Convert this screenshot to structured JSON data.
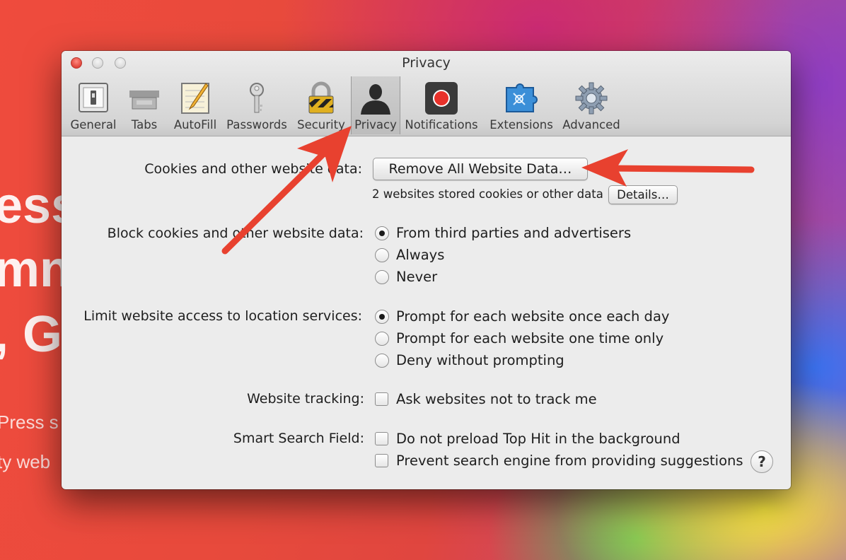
{
  "background": {
    "large_text": [
      "ess",
      "mn",
      ", G"
    ],
    "small_text": [
      "Press s",
      "ty web"
    ]
  },
  "window": {
    "title": "Privacy"
  },
  "toolbar": {
    "tabs": [
      {
        "label": "General",
        "icon": "general-switch-icon"
      },
      {
        "label": "Tabs",
        "icon": "tabs-icon"
      },
      {
        "label": "AutoFill",
        "icon": "autofill-pencil-icon"
      },
      {
        "label": "Passwords",
        "icon": "key-icon"
      },
      {
        "label": "Security",
        "icon": "padlock-icon"
      },
      {
        "label": "Privacy",
        "icon": "person-silhouette-icon"
      },
      {
        "label": "Notifications",
        "icon": "notifications-red-dot-icon"
      },
      {
        "label": "Extensions",
        "icon": "puzzle-piece-icon"
      },
      {
        "label": "Advanced",
        "icon": "gear-icon"
      }
    ],
    "selected": "Privacy"
  },
  "cookies": {
    "label": "Cookies and other website data:",
    "remove_button": "Remove All Website Data…",
    "status": "2 websites stored cookies or other data",
    "details_button": "Details…"
  },
  "block_cookies": {
    "label": "Block cookies and other website data:",
    "options": [
      "From third parties and advertisers",
      "Always",
      "Never"
    ],
    "selected": "From third parties and advertisers"
  },
  "location": {
    "label": "Limit website access to location services:",
    "options": [
      "Prompt for each website once each day",
      "Prompt for each website one time only",
      "Deny without prompting"
    ],
    "selected": "Prompt for each website once each day"
  },
  "tracking": {
    "label": "Website tracking:",
    "option": "Ask websites not to track me",
    "checked": false
  },
  "smart_search": {
    "label": "Smart Search Field:",
    "options": [
      "Do not preload Top Hit in the background",
      "Prevent search engine from providing suggestions"
    ]
  },
  "help_button": "?",
  "colors": {
    "annotation_arrow": "#e8412f",
    "close_button": "#e0443a"
  }
}
